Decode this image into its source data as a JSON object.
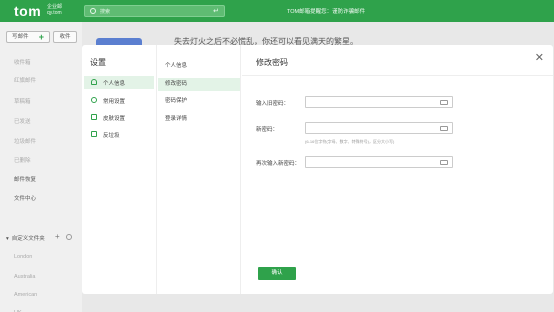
{
  "topbar": {
    "logo": "tom",
    "logo_sub_1": "企业邮",
    "logo_sub_2": "qy.tom",
    "search_placeholder": "搜索",
    "search_enter_icon": "enter-icon",
    "notice": "TOM邮箱提醒您：谨防诈骗邮件",
    "color": "#2fa24b"
  },
  "sidebar": {
    "write_label": "写邮件",
    "receive_label": "收件",
    "items": [
      "收件箱",
      "红旗邮件",
      "草稿箱",
      "已发送",
      "垃圾邮件",
      "已删除",
      "邮件恢复",
      "文件中心"
    ],
    "custom_folder_label": "自定义文件夹",
    "custom_folders": [
      "London",
      "Australia",
      "American",
      "UK"
    ]
  },
  "background": {
    "quote": "失去灯火之后不必慌乱，你还可以看见满天的繁星。"
  },
  "modal": {
    "title": "设置",
    "nav": [
      {
        "label": "个人信息",
        "icon": "user-icon"
      },
      {
        "label": "常用设置",
        "icon": "gear-icon"
      },
      {
        "label": "皮肤设置",
        "icon": "shirt-icon"
      },
      {
        "label": "反垃圾",
        "icon": "trash-icon"
      }
    ],
    "subnav": [
      "个人信息",
      "修改密码",
      "密码保护",
      "登录详情"
    ],
    "panel": {
      "title": "修改密码",
      "old_password_label": "输入旧密码：",
      "new_password_label": "新密码：",
      "new_password_hint": "(6-16位字符(字母、数字、特殊符号)，区分大小写)",
      "confirm_password_label": "再次输入新密码：",
      "confirm_button": "确认"
    }
  }
}
